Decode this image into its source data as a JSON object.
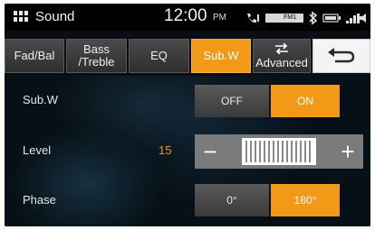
{
  "status_bar": {
    "app_title": "Sound",
    "time": "12:00",
    "ampm": "PM",
    "source_badge": "FM1"
  },
  "tabs": [
    {
      "label": "Fad/Bal"
    },
    {
      "label": "Bass /Treble"
    },
    {
      "label": "EQ"
    },
    {
      "label": "Sub.W",
      "active": true
    },
    {
      "label": "Advanced"
    }
  ],
  "subw": {
    "label": "Sub.W",
    "off_label": "OFF",
    "on_label": "ON",
    "selected": "ON"
  },
  "level": {
    "label": "Level",
    "value": "15",
    "minus_label": "−",
    "plus_label": "+"
  },
  "phase": {
    "label": "Phase",
    "opt1_label": "0°",
    "opt2_label": "180°",
    "selected": "180°"
  },
  "colors": {
    "accent": "#f29a18",
    "button": "#4a4a4a",
    "background": "#0a0e12"
  },
  "icons": [
    "menu-grid-icon",
    "phone-icon",
    "fm-badge-icon",
    "bluetooth-icon",
    "battery-icon",
    "signal-icon",
    "volume-icon",
    "swap-arrows-icon",
    "back-arrow-icon"
  ]
}
